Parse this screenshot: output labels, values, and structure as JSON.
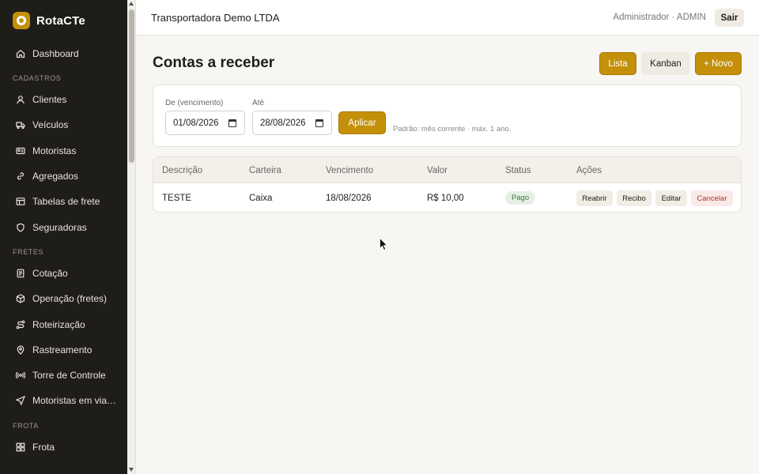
{
  "sidebar": {
    "brand": "RotaCTe",
    "items": [
      {
        "label": "Dashboard",
        "icon": "home-icon"
      },
      {
        "section": "CADASTROS"
      },
      {
        "label": "Clientes",
        "icon": "user-icon"
      },
      {
        "label": "Veículos",
        "icon": "truck-icon"
      },
      {
        "label": "Motoristas",
        "icon": "id-card-icon"
      },
      {
        "label": "Agregados",
        "icon": "link-icon"
      },
      {
        "label": "Tabelas de frete",
        "icon": "table-icon"
      },
      {
        "label": "Seguradoras",
        "icon": "shield-icon"
      },
      {
        "section": "FRETES"
      },
      {
        "label": "Cotação",
        "icon": "document-icon"
      },
      {
        "label": "Operação (fretes)",
        "icon": "package-icon"
      },
      {
        "label": "Roteirização",
        "icon": "route-icon"
      },
      {
        "label": "Rastreamento",
        "icon": "map-pin-icon"
      },
      {
        "label": "Torre de Controle",
        "icon": "radio-tower-icon"
      },
      {
        "label": "Motoristas em viag…",
        "icon": "send-icon"
      },
      {
        "section": "FROTA"
      },
      {
        "label": "Frota",
        "icon": "grid-icon"
      }
    ]
  },
  "topbar": {
    "company": "Transportadora Demo LTDA",
    "user": "Administrador · ADMIN",
    "logout_label": "Sair"
  },
  "page": {
    "title": "Contas a receber",
    "view_list_label": "Lista",
    "view_kanban_label": "Kanban",
    "new_label": "+ Novo"
  },
  "filters": {
    "from_label": "De (vencimento)",
    "from_value": "01/08/2026",
    "to_label": "Até",
    "to_value": "28/08/2026",
    "apply_label": "Aplicar",
    "hint": "Padrão: mês corrente · máx. 1 ano."
  },
  "table": {
    "columns": [
      "Descrição",
      "Carteira",
      "Vencimento",
      "Valor",
      "Status",
      "Ações"
    ],
    "rows": [
      {
        "descricao": "TESTE",
        "carteira": "Caixa",
        "vencimento": "18/08/2026",
        "valor": "R$ 10,00",
        "status": "Pago",
        "actions": [
          "Reabrir",
          "Recibo",
          "Editar",
          "Cancelar"
        ]
      }
    ]
  },
  "colors": {
    "accent": "#c4900a",
    "sidebar_bg": "#1f1d1a",
    "status_paid_bg": "#e7efe5",
    "status_paid_fg": "#3c7d3a",
    "danger_fg": "#b3352b"
  }
}
